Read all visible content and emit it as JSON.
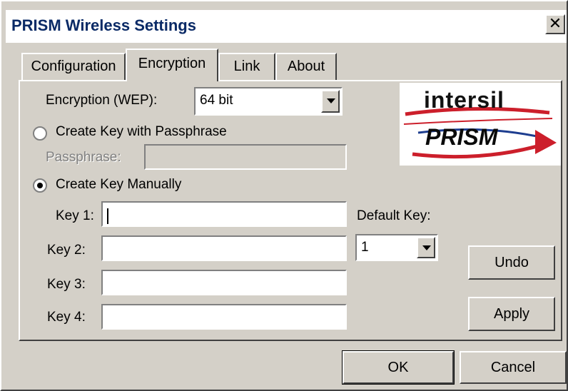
{
  "window": {
    "title": "PRISM Wireless Settings",
    "close_glyph": "✕"
  },
  "tabs": [
    {
      "label": "Configuration"
    },
    {
      "label": "Encryption"
    },
    {
      "label": "Link"
    },
    {
      "label": "About"
    }
  ],
  "encryption": {
    "wep_label": "Encryption (WEP):",
    "wep_value": "64 bit",
    "passphrase_option": "Create Key with Passphrase",
    "passphrase_label": "Passphrase:",
    "passphrase_value": "",
    "manual_option": "Create Key Manually",
    "selected_option": "manual"
  },
  "keys": [
    {
      "label": "Key 1:",
      "value": ""
    },
    {
      "label": "Key 2:",
      "value": ""
    },
    {
      "label": "Key 3:",
      "value": ""
    },
    {
      "label": "Key 4:",
      "value": ""
    }
  ],
  "default_key": {
    "label": "Default Key:",
    "value": "1"
  },
  "buttons": {
    "undo": "Undo",
    "apply": "Apply",
    "ok": "OK",
    "cancel": "Cancel"
  },
  "logo": {
    "brand": "intersil",
    "product": "PRISM",
    "colors": {
      "swoosh_red": "#cc1f2b",
      "swoosh_blue": "#1d3d8f"
    }
  },
  "colors": {
    "face": "#d4d0c8",
    "title_text": "#0a2a66"
  }
}
